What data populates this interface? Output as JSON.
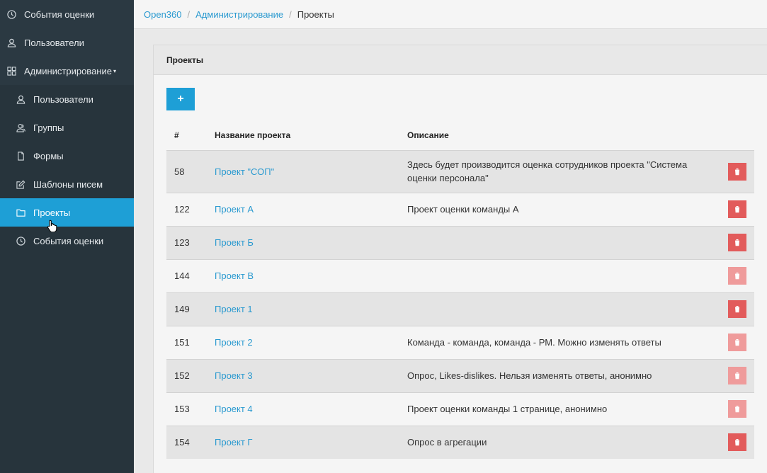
{
  "sidebar": {
    "top_items": [
      {
        "label": "События оценки",
        "icon": "clock-icon"
      },
      {
        "label": "Пользователи",
        "icon": "user-icon"
      },
      {
        "label": "Администрирование",
        "icon": "grid-icon",
        "caret": "▾"
      }
    ],
    "sub_items": [
      {
        "label": "Пользователи",
        "icon": "user-icon"
      },
      {
        "label": "Группы",
        "icon": "users-icon"
      },
      {
        "label": "Формы",
        "icon": "file-icon"
      },
      {
        "label": "Шаблоны писем",
        "icon": "edit-icon"
      },
      {
        "label": "Проекты",
        "icon": "folder-icon",
        "active": true
      },
      {
        "label": "События оценки",
        "icon": "clock-icon"
      }
    ]
  },
  "breadcrumb": {
    "items": [
      "Open360",
      "Администрирование"
    ],
    "separator": "/",
    "current": "Проекты"
  },
  "panel": {
    "title": "Проекты",
    "add_label": "+"
  },
  "table": {
    "headers": {
      "id": "#",
      "name": "Название проекта",
      "description": "Описание"
    },
    "rows": [
      {
        "id": "58",
        "name": "Проект \"СОП\"",
        "description": "Здесь будет производится оценка сотрудников проекта \"Система оценки персонала\"",
        "delete_enabled": true
      },
      {
        "id": "122",
        "name": "Проект А",
        "description": "Проект оценки команды А",
        "delete_enabled": true
      },
      {
        "id": "123",
        "name": "Проект Б",
        "description": "",
        "delete_enabled": true
      },
      {
        "id": "144",
        "name": "Проект В",
        "description": "",
        "delete_enabled": false
      },
      {
        "id": "149",
        "name": "Проект 1",
        "description": "",
        "delete_enabled": true
      },
      {
        "id": "151",
        "name": "Проект 2",
        "description": "Команда - команда, команда - РМ. Можно изменять ответы",
        "delete_enabled": false
      },
      {
        "id": "152",
        "name": "Проект 3",
        "description": "Опрос, Likes-dislikes. Нельзя изменять ответы, анонимно",
        "delete_enabled": false
      },
      {
        "id": "153",
        "name": "Проект 4",
        "description": "Проект оценки команды 1 странице, анонимно",
        "delete_enabled": false
      },
      {
        "id": "154",
        "name": "Проект Г",
        "description": "Опрос в агрегации",
        "delete_enabled": true
      }
    ]
  },
  "colors": {
    "sidebar_bg": "#27343c",
    "accent": "#1e9fd6",
    "link": "#2b9ad0",
    "delete": "#e25b5b",
    "delete_disabled": "#ef9b9b"
  }
}
